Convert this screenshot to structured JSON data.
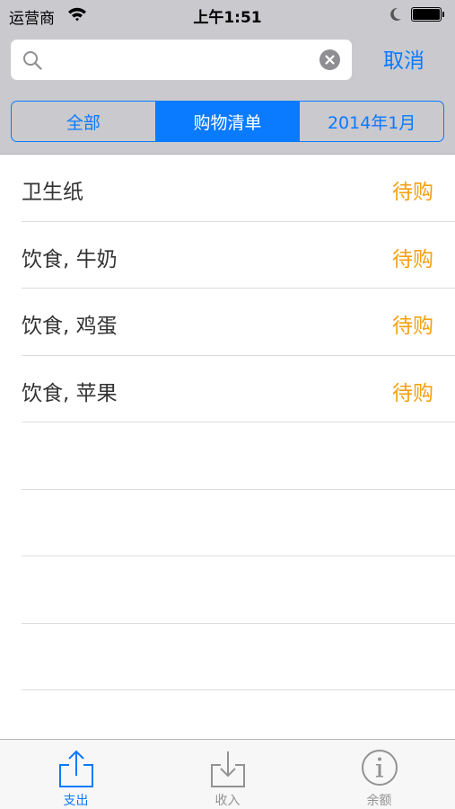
{
  "status_bar": {
    "carrier": "运营商",
    "time": "上午1:51"
  },
  "search": {
    "value": "",
    "placeholder": "",
    "cancel_label": "取消"
  },
  "segments": [
    {
      "label": "全部",
      "selected": false
    },
    {
      "label": "购物清单",
      "selected": true
    },
    {
      "label": "2014年1月",
      "selected": false
    }
  ],
  "items": [
    {
      "title": "卫生纸",
      "status": "待购"
    },
    {
      "title": "饮食, 牛奶",
      "status": "待购"
    },
    {
      "title": "饮食, 鸡蛋",
      "status": "待购"
    },
    {
      "title": "饮食, 苹果",
      "status": "待购"
    }
  ],
  "tabs": [
    {
      "label": "支出",
      "icon": "share-up-icon",
      "active": true
    },
    {
      "label": "收入",
      "icon": "download-tray-icon",
      "active": false
    },
    {
      "label": "余额",
      "icon": "info-circle-icon",
      "active": false
    }
  ],
  "colors": {
    "accent": "#0a7aff",
    "status_pending": "#f3a113",
    "header_bg": "#c9c9ce"
  }
}
